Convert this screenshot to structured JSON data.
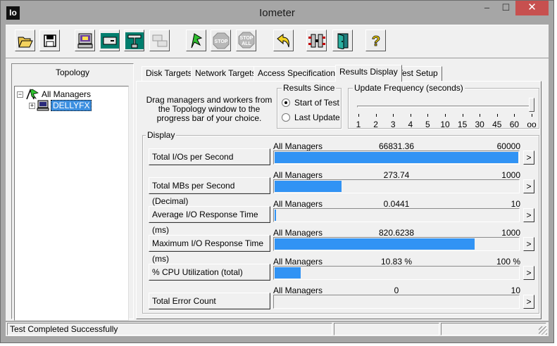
{
  "app": {
    "icon_text": "Io",
    "title": "Iometer",
    "min_glyph": "–",
    "max_glyph": "☐",
    "close_glyph": "✕"
  },
  "toolbar": {
    "icons": [
      "open-config-icon",
      "save-config-icon",
      "display-manager-icon",
      "new-worker-icon",
      "new-network-worker-icon",
      "duplicate-worker-icon",
      "start-icon",
      "stop-icon",
      "stop-all-icon",
      "reset-workers-icon",
      "disconnect-icon",
      "exit-icon",
      "about-icon"
    ],
    "stop_text": "STOP",
    "stop_all_text": "STOP",
    "all_text": "ALL",
    "about_text": "?"
  },
  "topology": {
    "title": "Topology",
    "root_label": "All Managers",
    "manager_label": "DELLYFX",
    "collapse_glyph": "−",
    "expand_glyph": "+"
  },
  "tabs": [
    {
      "label": "Disk Targets",
      "active": false
    },
    {
      "label": "Network Targets",
      "active": false
    },
    {
      "label": "Access Specifications",
      "active": false
    },
    {
      "label": "Results Display",
      "active": true
    },
    {
      "label": "Test Setup",
      "active": false
    }
  ],
  "results": {
    "drag_note": "Drag managers and workers from the Topology window to the progress bar of your choice.",
    "results_since": {
      "title": "Results Since",
      "options": [
        {
          "label": "Start of Test",
          "selected": true
        },
        {
          "label": "Last Update",
          "selected": false
        }
      ]
    },
    "update_frequency": {
      "title": "Update Frequency (seconds)",
      "ticks": [
        "1",
        "2",
        "3",
        "4",
        "5",
        "10",
        "15",
        "30",
        "45",
        "60",
        "oo"
      ],
      "selected": "oo"
    },
    "display_title": "Display",
    "arrow_glyph": ">",
    "metrics": [
      {
        "button": "Total I/Os per Second",
        "manager": "All Managers",
        "value": "66831.36",
        "max": "60000",
        "fill_fraction": 1.0
      },
      {
        "button": "Total MBs per Second (Decimal)",
        "manager": "All Managers",
        "value": "273.74",
        "max": "1000",
        "fill_fraction": 0.2737
      },
      {
        "button": "Average I/O Response Time (ms)",
        "manager": "All Managers",
        "value": "0.0441",
        "max": "10",
        "fill_fraction": 0.0044
      },
      {
        "button": "Maximum I/O Response Time (ms)",
        "manager": "All Managers",
        "value": "820.6238",
        "max": "1000",
        "fill_fraction": 0.8206
      },
      {
        "button": "% CPU Utilization (total)",
        "manager": "All Managers",
        "value": "10.83 %",
        "max": "100 %",
        "fill_fraction": 0.1083
      },
      {
        "button": "Total Error Count",
        "manager": "All Managers",
        "value": "0",
        "max": "10",
        "fill_fraction": 0
      }
    ]
  },
  "status": {
    "message": "Test Completed Successfully"
  }
}
